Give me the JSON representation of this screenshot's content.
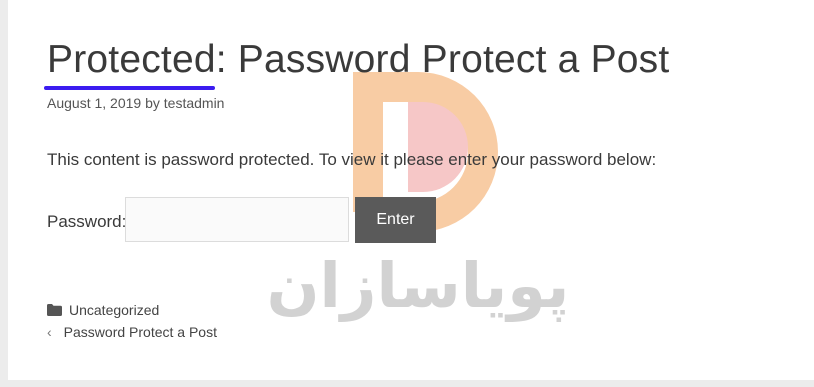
{
  "post": {
    "title": "Protected: Password Protect a Post",
    "date": "August 1, 2019",
    "by": "by",
    "author": "testadmin",
    "protected_message": "This content is password protected. To view it please enter your password below:"
  },
  "form": {
    "password_label": "Password:",
    "password_value": "",
    "enter_label": "Enter"
  },
  "footer": {
    "category_icon": "folder-icon",
    "category": "Uncategorized",
    "prev_icon": "chevron-left-icon",
    "prev_chevron": "‹",
    "prev_post": "Password Protect a Post"
  },
  "watermark": {
    "text": "پویاسازان",
    "logo_color": "#f3a35a",
    "logo_inner_color": "#ef9a9a",
    "text_color": "#c8c8c8"
  },
  "colors": {
    "accent_underline": "#3b1cf0",
    "button_bg": "#5a5a5a"
  }
}
